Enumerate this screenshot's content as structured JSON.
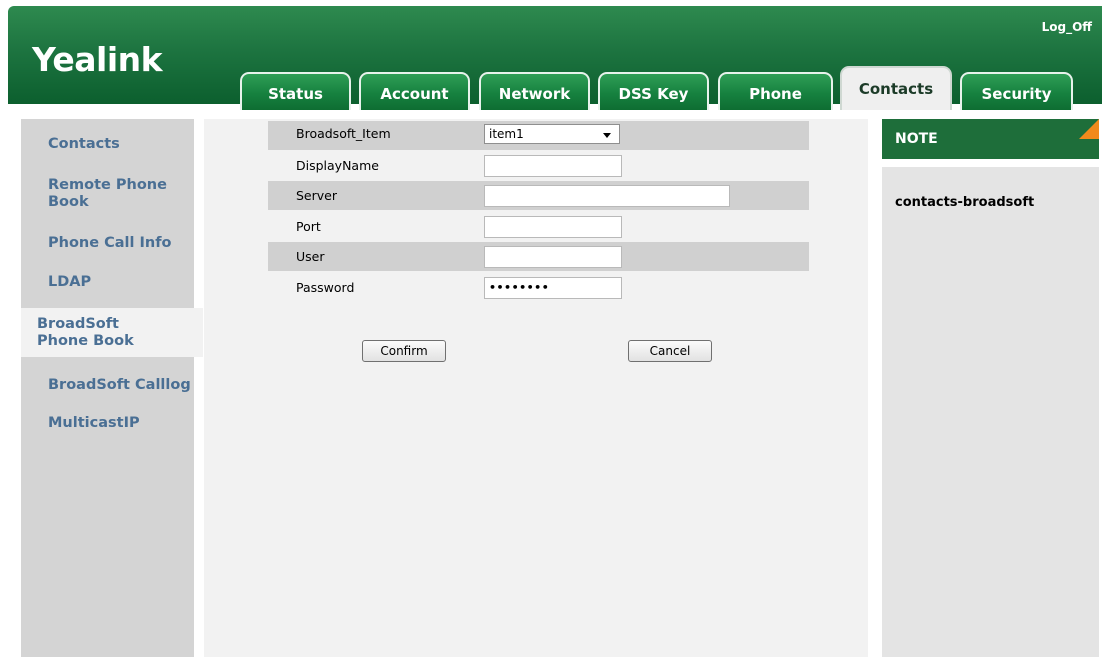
{
  "header": {
    "logo": "Yealink",
    "logoff": "Log_Off",
    "colors": {
      "header_green": "#1d7440",
      "link_blue": "#4a6f94",
      "note_accent": "#f28a1c"
    }
  },
  "tabs": [
    {
      "label": "Status"
    },
    {
      "label": "Account"
    },
    {
      "label": "Network"
    },
    {
      "label": "DSS Key"
    },
    {
      "label": "Phone"
    },
    {
      "label": "Contacts",
      "active": true
    },
    {
      "label": "Security"
    }
  ],
  "sidebar": {
    "items": [
      {
        "label": "Contacts"
      },
      {
        "label": "Remote Phone Book"
      },
      {
        "label": "Phone Call Info"
      },
      {
        "label": "LDAP"
      },
      {
        "label": "BroadSoft Phone Book",
        "active": true
      },
      {
        "label": "BroadSoft Calllog"
      },
      {
        "label": "MulticastIP"
      }
    ]
  },
  "form": {
    "broadsoft_item": {
      "label": "Broadsoft_Item",
      "value": "item1"
    },
    "display_name": {
      "label": "DisplayName",
      "value": ""
    },
    "server": {
      "label": "Server",
      "value": ""
    },
    "port": {
      "label": "Port",
      "value": ""
    },
    "user": {
      "label": "User",
      "value": ""
    },
    "password": {
      "label": "Password",
      "value": "••••••••"
    },
    "confirm_label": "Confirm",
    "cancel_label": "Cancel"
  },
  "note": {
    "title": "NOTE",
    "text": "contacts-broadsoft"
  }
}
